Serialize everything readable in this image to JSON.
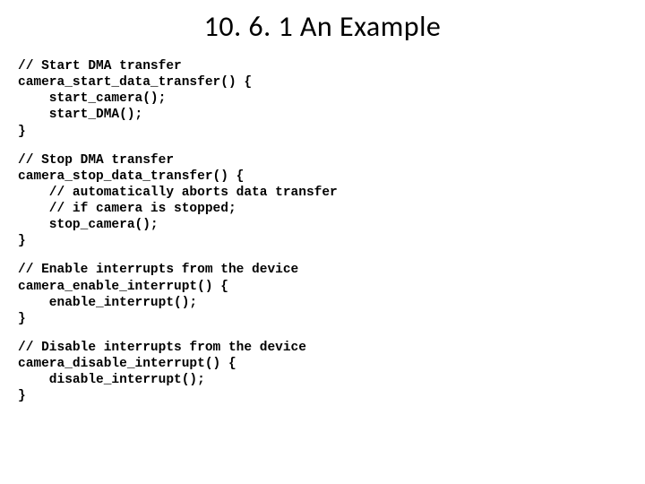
{
  "title": "10. 6. 1 An Example",
  "blocks": [
    "// Start DMA transfer\ncamera_start_data_transfer() {\n    start_camera();\n    start_DMA();\n}",
    "// Stop DMA transfer\ncamera_stop_data_transfer() {\n    // automatically aborts data transfer\n    // if camera is stopped;\n    stop_camera();\n}",
    "// Enable interrupts from the device\ncamera_enable_interrupt() {\n    enable_interrupt();\n}",
    "// Disable interrupts from the device\ncamera_disable_interrupt() {\n    disable_interrupt();\n}"
  ]
}
